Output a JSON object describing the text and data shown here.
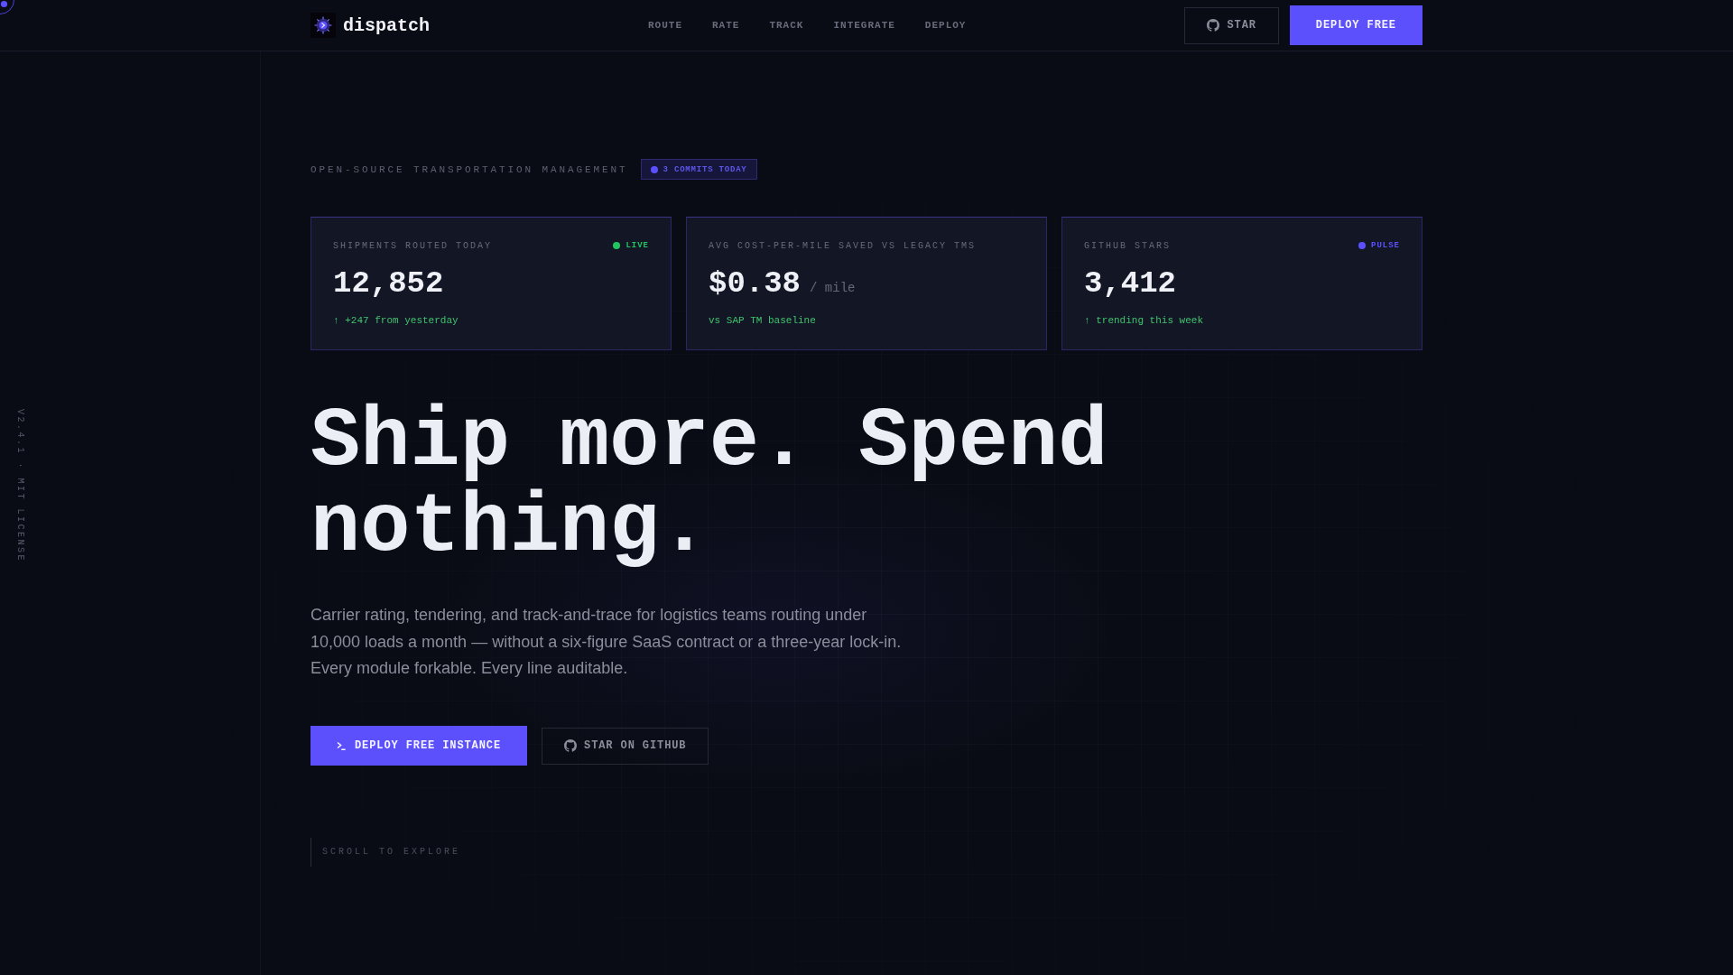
{
  "nav": {
    "brand": "dispatch",
    "links": [
      {
        "label": "ROUTE"
      },
      {
        "label": "RATE"
      },
      {
        "label": "TRACK"
      },
      {
        "label": "INTEGRATE"
      },
      {
        "label": "DEPLOY"
      }
    ],
    "buttons": [
      {
        "label": "STAR",
        "kind": "outline"
      },
      {
        "label": "DEPLOY FREE",
        "kind": "solid"
      }
    ]
  },
  "side_note": "V2.4.1 · MIT LICENSE",
  "hero": {
    "eyebrow": "OPEN-SOURCE TRANSPORTATION MANAGEMENT",
    "badge": "3 COMMITS TODAY",
    "stats": [
      {
        "label": "SHIPMENTS ROUTED TODAY",
        "status": {
          "label": "LIVE",
          "color": "#22c55e"
        },
        "value": "12,852",
        "note": "↑ +247 from yesterday"
      },
      {
        "label": "AVG COST-PER-MILE SAVED VS LEGACY TMS",
        "value": "$0.38",
        "unit": "/ mile",
        "note": "vs SAP TM baseline"
      },
      {
        "label": "GITHUB STARS",
        "status": {
          "label": "PULSE",
          "color": "#5b4fff"
        },
        "value": "3,412",
        "note": "↑ trending this week"
      }
    ],
    "headline": "Ship more. Spend nothing.",
    "lead": "Carrier rating, tendering, and track-and-trace for logistics teams routing under 10,000 loads a month — without a six-figure SaaS contract or a three-year lock-in. Every module forkable. Every line auditable.",
    "actions": [
      {
        "label": "DEPLOY FREE INSTANCE",
        "kind": "command"
      },
      {
        "label": "STAR ON GITHUB",
        "kind": "outline"
      }
    ],
    "scroll_hint": "SCROLL TO EXPLORE"
  }
}
